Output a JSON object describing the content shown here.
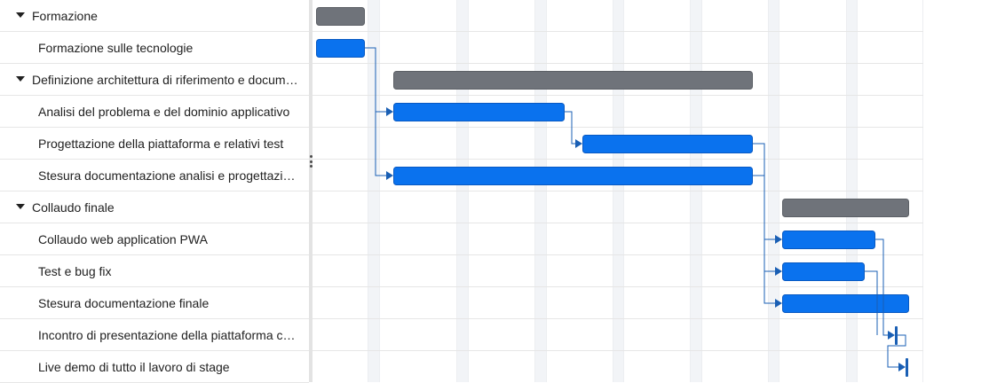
{
  "tasks": [
    {
      "name": "Formazione",
      "kind": "group"
    },
    {
      "name": "Formazione sulle tecnologie",
      "kind": "task"
    },
    {
      "name": "Definizione architettura di riferimento e documentazione",
      "kind": "group"
    },
    {
      "name": "Analisi del problema e del dominio applicativo",
      "kind": "task"
    },
    {
      "name": "Progettazione della piattaforma e relativi test",
      "kind": "task"
    },
    {
      "name": "Stesura documentazione analisi e progettazione",
      "kind": "task"
    },
    {
      "name": "Collaudo finale",
      "kind": "group"
    },
    {
      "name": "Collaudo web application PWA",
      "kind": "task"
    },
    {
      "name": "Test e bug fix",
      "kind": "task"
    },
    {
      "name": "Stesura documentazione finale",
      "kind": "task"
    },
    {
      "name": "Incontro di presentazione della piattaforma con il cliente",
      "kind": "milestone"
    },
    {
      "name": "Live demo di tutto il lavoro di stage",
      "kind": "milestone"
    }
  ],
  "colors": {
    "summary_bar": "#6f737a",
    "task_bar": "#0a72ee",
    "task_bar_border": "#0859c2",
    "connector": "#1a5fb4",
    "weekend_band": "#f2f4f7",
    "grid_line": "#e6e6e6"
  }
}
